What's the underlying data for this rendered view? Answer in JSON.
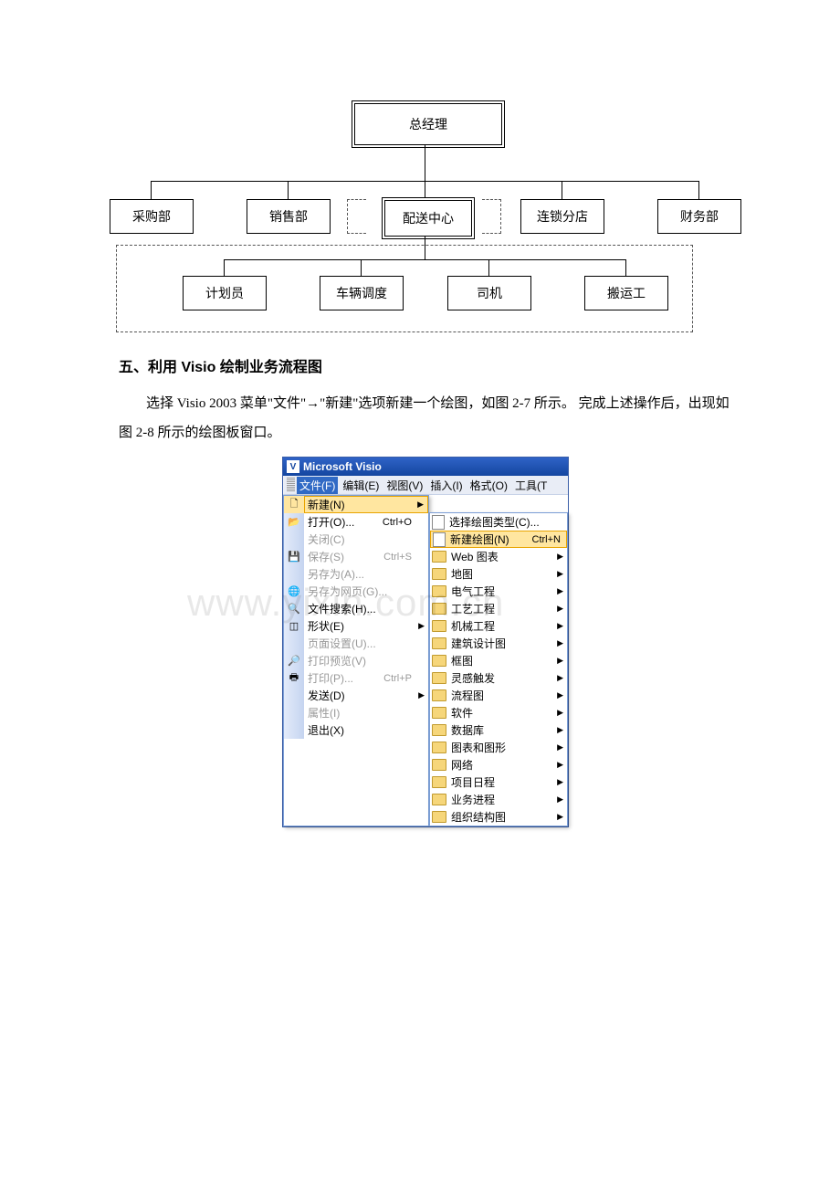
{
  "org": {
    "top": "总经理",
    "r1": [
      "采购部",
      "销售部",
      "配送中心",
      "连锁分店",
      "财务部"
    ],
    "r2": [
      "计划员",
      "车辆调度",
      "司机",
      "搬运工"
    ]
  },
  "doc": {
    "heading": "五、利用 Visio 绘制业务流程图",
    "para": "选择 Visio 2003 菜单\"文件\"→\"新建\"选项新建一个绘图，如图  2-7 所示。 完成上述操作后，出现如图 2-8 所示的绘图板窗口。"
  },
  "visio": {
    "title": "Microsoft Visio",
    "menubar": [
      "文件(F)",
      "编辑(E)",
      "视图(V)",
      "插入(I)",
      "格式(O)",
      "工具(T"
    ],
    "file_items": [
      {
        "label": "新建(N)",
        "icon": "new",
        "active": true,
        "arrow": true
      },
      {
        "label": "打开(O)...",
        "icon": "open",
        "sc": "Ctrl+O"
      },
      {
        "label": "关闭(C)",
        "disabled": true
      },
      {
        "label": "保存(S)",
        "icon": "save",
        "sc": "Ctrl+S",
        "disabled": true
      },
      {
        "label": "另存为(A)...",
        "disabled": true
      },
      {
        "label": "另存为网页(G)...",
        "icon": "web",
        "disabled": true
      },
      {
        "label": "文件搜索(H)...",
        "icon": "search"
      },
      {
        "label": "形状(E)",
        "icon": "shapes",
        "arrow": true
      },
      {
        "label": "页面设置(U)...",
        "disabled": true
      },
      {
        "label": "打印预览(V)",
        "icon": "preview",
        "disabled": true
      },
      {
        "label": "打印(P)...",
        "icon": "print",
        "sc": "Ctrl+P",
        "disabled": true
      },
      {
        "label": "发送(D)",
        "arrow": true
      },
      {
        "label": "属性(I)",
        "disabled": true
      },
      {
        "label": "退出(X)"
      }
    ],
    "sub_items": [
      {
        "label": "选择绘图类型(C)...",
        "blank": true
      },
      {
        "label": "新建绘图(N)",
        "blank": true,
        "sc": "Ctrl+N",
        "active": true
      },
      {
        "label": "Web 图表",
        "arrow": true
      },
      {
        "label": "地图",
        "arrow": true
      },
      {
        "label": "电气工程",
        "arrow": true
      },
      {
        "label": "工艺工程",
        "arrow": true
      },
      {
        "label": "机械工程",
        "arrow": true
      },
      {
        "label": "建筑设计图",
        "arrow": true
      },
      {
        "label": "框图",
        "arrow": true
      },
      {
        "label": "灵感触发",
        "arrow": true
      },
      {
        "label": "流程图",
        "arrow": true
      },
      {
        "label": "软件",
        "arrow": true
      },
      {
        "label": "数据库",
        "arrow": true
      },
      {
        "label": "图表和图形",
        "arrow": true
      },
      {
        "label": "网络",
        "arrow": true
      },
      {
        "label": "项目日程",
        "arrow": true
      },
      {
        "label": "业务进程",
        "arrow": true
      },
      {
        "label": "组织结构图",
        "arrow": true
      }
    ]
  },
  "watermark": "www.yixin.com.cn"
}
